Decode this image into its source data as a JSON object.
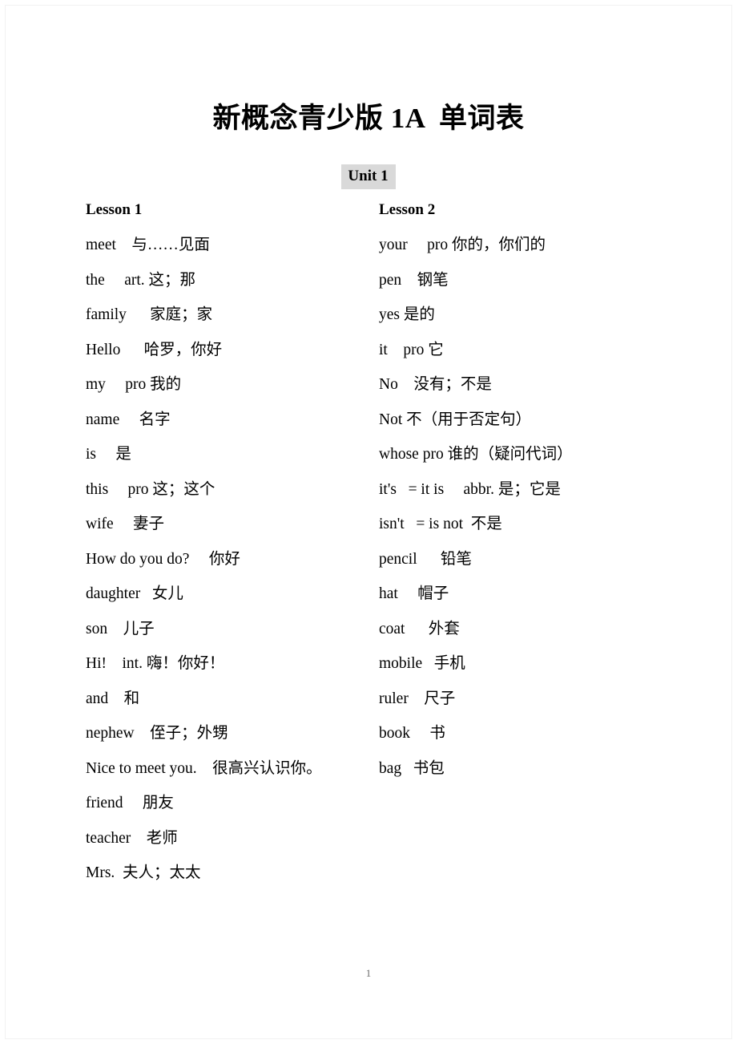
{
  "document": {
    "title": "新概念青少版 1A  单词表",
    "page_number": "1",
    "unit_label": "Unit 1",
    "highlight_color": "#d9d9d9"
  },
  "columns": {
    "left": {
      "lesson_heading": "Lesson 1",
      "entries": [
        "meet    与……见面",
        "the     art. 这；那",
        "family      家庭；家",
        "Hello      哈罗，你好",
        "my     pro 我的",
        "name     名字",
        "is     是",
        "this     pro 这；这个",
        "wife     妻子",
        "How do you do?     你好",
        "daughter   女儿",
        "son    儿子",
        "Hi!    int. 嗨！你好！",
        "and    和",
        "nephew    侄子；外甥",
        "Nice to meet you.    很高兴认识你。",
        "friend     朋友",
        "teacher    老师",
        "Mrs.  夫人；太太"
      ]
    },
    "right": {
      "lesson_heading": "Lesson 2",
      "entries": [
        "your     pro 你的，你们的",
        "pen    钢笔",
        "yes 是的",
        "it    pro 它",
        "No    没有；不是",
        "Not 不（用于否定句）",
        "whose pro 谁的（疑问代词）",
        "it's   = it is     abbr. 是；它是",
        "isn't   = is not  不是",
        "pencil      铅笔",
        "hat     帽子",
        "coat      外套",
        "mobile   手机",
        "ruler    尺子",
        "book     书",
        "bag   书包"
      ]
    }
  }
}
